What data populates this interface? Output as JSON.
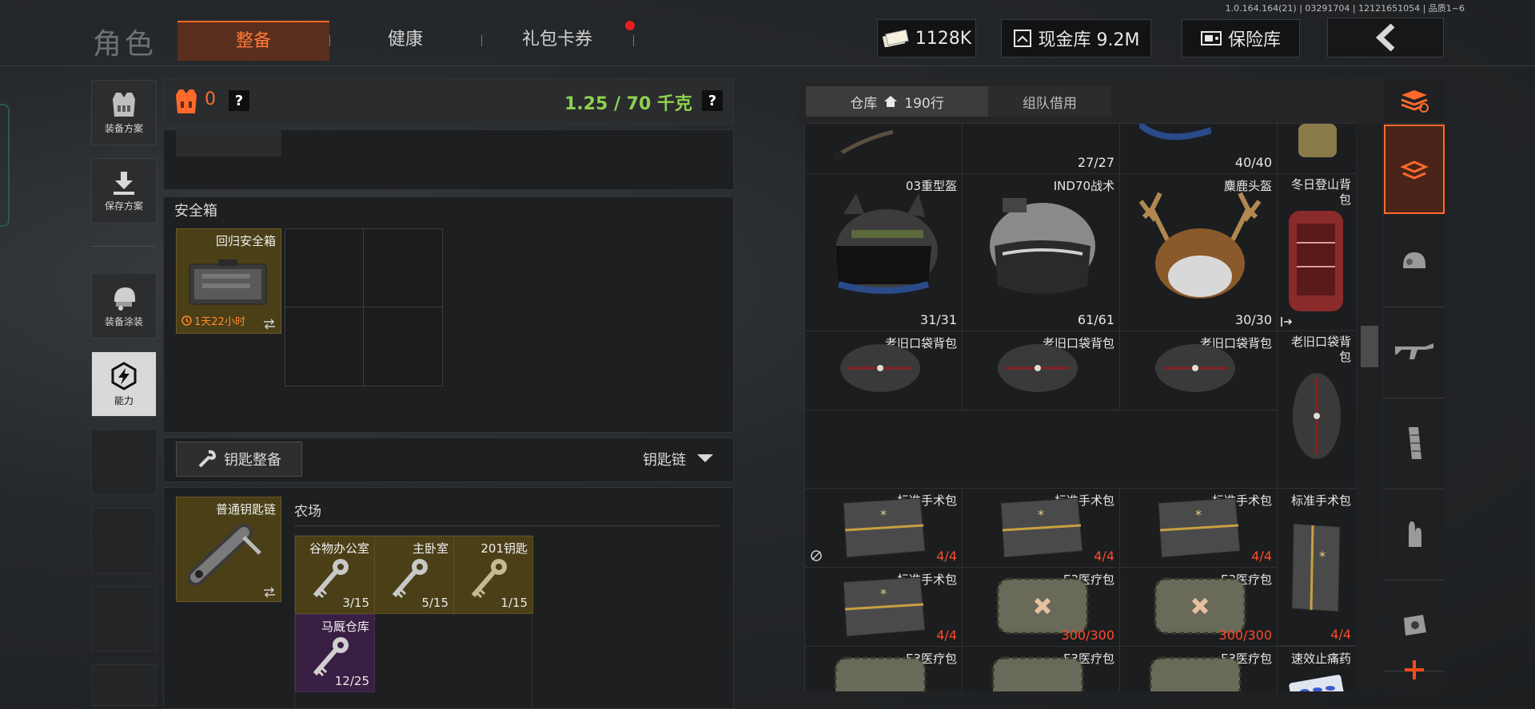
{
  "version": "1.0.164.164(21) | 03291704 | 12121651054 | 品质1~6",
  "header": {
    "title": "角色",
    "tabs": [
      {
        "label": "整备",
        "active": true
      },
      {
        "label": "健康",
        "active": false
      },
      {
        "label": "礼包卡券",
        "active": false,
        "has_notification": true
      }
    ],
    "currency": "1128K",
    "cash_vault_label": "现金库 9.2M",
    "safe_label": "保险库"
  },
  "sidebar": [
    {
      "label": "装备方案",
      "icon": "vest-icon"
    },
    {
      "label": "保存方案",
      "icon": "download-icon"
    },
    {
      "label": "装备涂装",
      "icon": "helmet-icon"
    },
    {
      "label": "能力",
      "icon": "lightning-icon"
    }
  ],
  "loadout": {
    "armor_count": "0",
    "help": "?",
    "weight": "1.25 / 70 千克",
    "weight_color": "#8fd14f"
  },
  "safebox": {
    "title": "安全箱",
    "item_name": "回归安全箱",
    "item_timer": "1天22小时"
  },
  "keys": {
    "title": "钥匙整备",
    "dropdown": "钥匙链",
    "keychain_name": "普通钥匙链",
    "location": "农场",
    "items": [
      {
        "name": "谷物办公室",
        "count": "3/15"
      },
      {
        "name": "主卧室",
        "count": "5/15"
      },
      {
        "name": "201钥匙",
        "count": "1/15"
      },
      {
        "name": "马厩仓库",
        "count": "12/25"
      }
    ]
  },
  "storage": {
    "tab_warehouse": "仓库",
    "warehouse_rows": "190行",
    "tab_team": "组队借用",
    "top_counts": [
      "27/27",
      "40/40"
    ],
    "rows": [
      [
        {
          "name": "03重型盔",
          "count": "31/31",
          "kind": "helmet-dark"
        },
        {
          "name": "IND70战术",
          "count": "61/61",
          "kind": "helmet-grey"
        },
        {
          "name": "麋鹿头盔",
          "count": "30/30",
          "kind": "helmet-antler"
        },
        {
          "name": "冬日登山背包",
          "count": "",
          "kind": "backpack-red"
        }
      ],
      [
        {
          "name": "老旧口袋背包",
          "count": "",
          "kind": "pouch"
        },
        {
          "name": "老旧口袋背包",
          "count": "",
          "kind": "pouch"
        },
        {
          "name": "老旧口袋背包",
          "count": "",
          "kind": "pouch"
        },
        {
          "name": "老旧口袋背包",
          "count": "",
          "kind": "pouch-tall"
        }
      ],
      [
        {
          "name": "标准手术包",
          "count": "4/4",
          "kind": "surgery"
        },
        {
          "name": "标准手术包",
          "count": "4/4",
          "kind": "surgery"
        },
        {
          "name": "标准手术包",
          "count": "4/4",
          "kind": "surgery"
        },
        {
          "name": "标准手术包",
          "count": "",
          "kind": "surgery-tall"
        }
      ],
      [
        {
          "name": "标准手术包",
          "count": "4/4",
          "kind": "surgery"
        },
        {
          "name": "E3医疗包",
          "count": "300/300",
          "kind": "medkit"
        },
        {
          "name": "E3医疗包",
          "count": "300/300",
          "kind": "medkit"
        },
        {
          "name": "",
          "count": "4/4",
          "kind": "empty"
        }
      ],
      [
        {
          "name": "E3医疗包",
          "count": "",
          "kind": "medkit"
        },
        {
          "name": "E3医疗包",
          "count": "",
          "kind": "medkit"
        },
        {
          "name": "E3医疗包",
          "count": "",
          "kind": "medkit"
        },
        {
          "name": "速效止痛药",
          "count": "",
          "kind": "pills"
        }
      ]
    ],
    "accent": "#ff4a2a"
  }
}
